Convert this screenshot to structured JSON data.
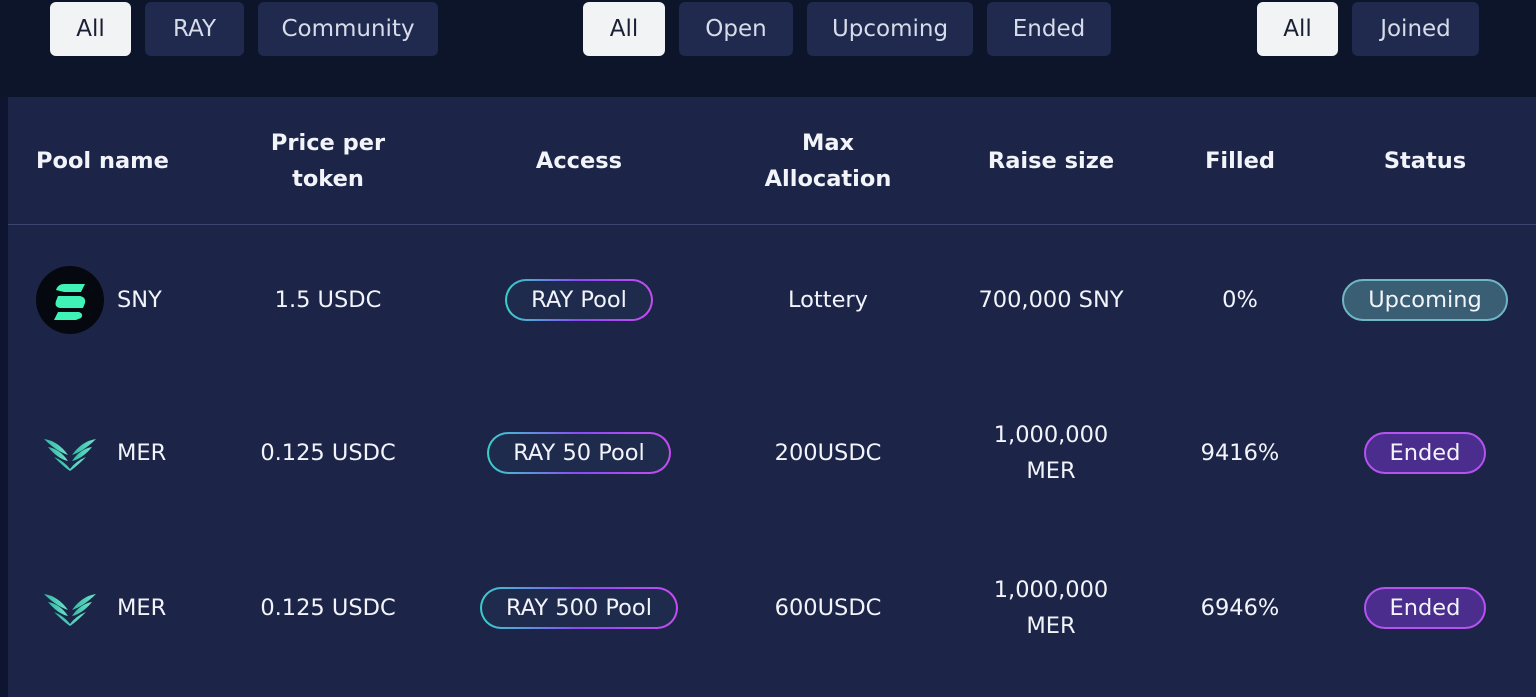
{
  "filters": {
    "category": [
      {
        "label": "All",
        "active": true
      },
      {
        "label": "RAY",
        "active": false
      },
      {
        "label": "Community",
        "active": false
      }
    ],
    "state": [
      {
        "label": "All",
        "active": true
      },
      {
        "label": "Open",
        "active": false
      },
      {
        "label": "Upcoming",
        "active": false
      },
      {
        "label": "Ended",
        "active": false
      }
    ],
    "membership": [
      {
        "label": "All",
        "active": true
      },
      {
        "label": "Joined",
        "active": false
      }
    ]
  },
  "table": {
    "headers": {
      "pool_name": "Pool name",
      "price_line1": "Price per",
      "price_line2": "token",
      "access": "Access",
      "max_line1": "Max",
      "max_line2": "Allocation",
      "raise_size": "Raise size",
      "filled": "Filled",
      "status": "Status"
    },
    "rows": [
      {
        "name": "SNY",
        "logo": "sny-logo-icon",
        "price": "1.5 USDC",
        "access": "RAY Pool",
        "max_allocation": "Lottery",
        "raise_line1": "700,000 SNY",
        "raise_line2": "",
        "filled": "0%",
        "status": "Upcoming"
      },
      {
        "name": "MER",
        "logo": "mer-logo-icon",
        "price": "0.125 USDC",
        "access": "RAY 50 Pool",
        "max_allocation": "200USDC",
        "raise_line1": "1,000,000",
        "raise_line2": "MER",
        "filled": "9416%",
        "status": "Ended"
      },
      {
        "name": "MER",
        "logo": "mer-logo-icon",
        "price": "0.125 USDC",
        "access": "RAY 500 Pool",
        "max_allocation": "600USDC",
        "raise_line1": "1,000,000",
        "raise_line2": "MER",
        "filled": "6946%",
        "status": "Ended"
      }
    ]
  },
  "colors": {
    "page_bg": "#0d152b",
    "panel_bg": "#1c2548",
    "button_bg": "#1f2a4e",
    "button_active_bg": "#f2f3f5",
    "accent_teal": "#39d0c8",
    "accent_purple": "#b552f0"
  }
}
